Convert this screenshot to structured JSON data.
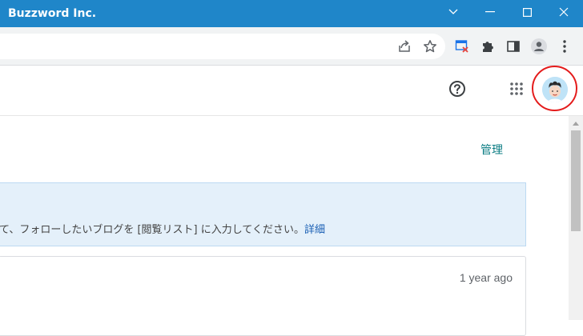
{
  "window": {
    "title": "Buzzword Inc."
  },
  "browser": {
    "toolbar_icons": [
      "share-icon",
      "star-icon",
      "extension-app-icon",
      "puzzle-icon",
      "side-panel-icon",
      "profile-icon",
      "more-menu-icon"
    ]
  },
  "header": {
    "icons": [
      "help-icon",
      "apps-grid-icon",
      "avatar"
    ]
  },
  "main": {
    "manage_link": "管理",
    "info": {
      "text": "て、フォローしたいブログを [閲覧リスト] に入力してください。",
      "link": "詳細"
    },
    "card": {
      "time": "1 year ago"
    }
  },
  "colors": {
    "titlebar": "#1f86c9",
    "link_teal": "#0b7c83",
    "info_bg": "#e4f0fa",
    "highlight": "#e41b1b"
  }
}
